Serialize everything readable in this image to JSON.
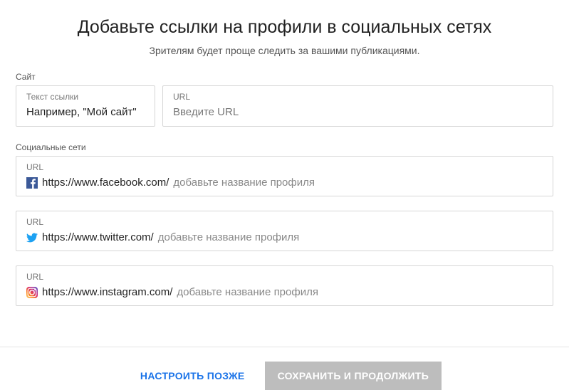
{
  "header": {
    "title": "Добавьте ссылки на профили в социальных сетях",
    "subtitle": "Зрителям будет проще следить за вашими публикациями."
  },
  "site": {
    "section_label": "Сайт",
    "text_label": "Текст ссылки",
    "text_value": "Например, \"Мой сайт\"",
    "url_label": "URL",
    "url_placeholder": "Введите URL"
  },
  "social": {
    "section_label": "Социальные сети",
    "url_label": "URL",
    "items": [
      {
        "icon": "facebook",
        "prefix": "https://www.facebook.com/",
        "suffix": "добавьте название профиля"
      },
      {
        "icon": "twitter",
        "prefix": "https://www.twitter.com/",
        "suffix": "добавьте название профиля"
      },
      {
        "icon": "instagram",
        "prefix": "https://www.instagram.com/",
        "suffix": "добавьте название профиля"
      }
    ]
  },
  "footer": {
    "later": "НАСТРОИТЬ ПОЗЖЕ",
    "save": "СОХРАНИТЬ И ПРОДОЛЖИТЬ"
  }
}
